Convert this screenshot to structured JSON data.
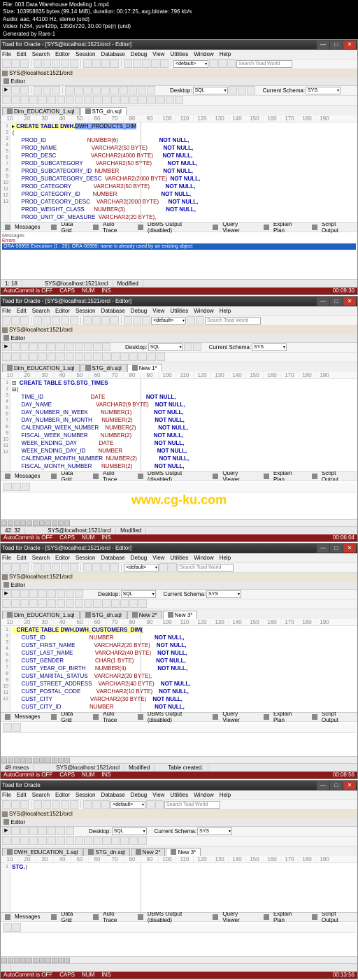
{
  "media_info": {
    "file": "File: 003 Data Warehouse Modeling 1.mp4",
    "size": "Size: 103958835 bytes (99.14 MiB), duration: 00:17:25, avg.bitrate: 796 kb/s",
    "audio": "Audio: aac, 44100 Hz, stereo (und)",
    "video": "Video: h264, yuv420p, 1350x720, 30.00 fps(r) (und)",
    "gen": "Generated by Rare-1"
  },
  "menus": [
    "File",
    "Edit",
    "Search",
    "Editor",
    "Session",
    "Database",
    "Debug",
    "View",
    "Utilities",
    "Window",
    "Help"
  ],
  "default_dd": "<default>",
  "search_ph": "Search Toad World",
  "sql_label": "SQL",
  "schema_label": "Current Schema:",
  "schema_val": "SYS",
  "conn": "SYS@localhost:1521/orcl",
  "editor_label": "Editor",
  "app1": {
    "title": "Toad for Oracle - [SYS@localhost:1521/orcl - Editor]",
    "tabs": [
      "Dim_EDUCATION_1.sql",
      "STG_dn.sql"
    ],
    "code_hl": "CREATE TABLE DWH.",
    "code_hl_sel": "DWH_PRODUCTS_DIM",
    "cols": [
      [
        "PROD_ID",
        "NUMBER(6)",
        "NOT NULL,"
      ],
      [
        "PROD_NAME",
        "VARCHAR2(50 BYTE)",
        "NOT NULL,"
      ],
      [
        "PROD_DESC",
        "VARCHAR2(4000 BYTE)",
        "NOT NULL,"
      ],
      [
        "PROD_SUBCATEGORY",
        "VARCHAR2(50 BYTE)",
        "NOT NULL,"
      ],
      [
        "PROD_SUBCATEGORY_ID",
        "NUMBER",
        "NOT NULL,"
      ],
      [
        "PROD_SUBCATEGORY_DESC",
        "VARCHAR2(2000 BYTE)",
        "NOT NULL,"
      ],
      [
        "PROD_CATEGORY",
        "VARCHAR2(50 BYTE)",
        "NOT NULL,"
      ],
      [
        "PROD_CATEGORY_ID",
        "NUMBER",
        "NOT NULL,"
      ],
      [
        "PROD_CATEGORY_DESC",
        "VARCHAR2(2000 BYTE)",
        "NOT NULL,"
      ],
      [
        "PROD_WEIGHT_CLASS",
        "NUMBER(3)",
        "NOT NULL,"
      ],
      [
        "PROD_UNIT_OF_MEASURE",
        "VARCHAR2(20 BYTE),",
        ""
      ]
    ],
    "msg_label": "Messages",
    "err_label": "Errors",
    "err_text": "ORA-00955 Execution (1 : 20): ORA-00955: name is already used by an existing object",
    "out_tabs": [
      "Messages",
      "Data Grid",
      "Auto Trace",
      "DBMS Output (disabled)",
      "Query Viewer",
      "Explain Plan",
      "Script Output"
    ],
    "status": [
      "1: 18",
      "",
      "",
      "SYS@localhost:1521/orcl",
      "Modified"
    ],
    "redbar": [
      "AutoCommit is OFF",
      "CAPS",
      "NUM",
      "INS"
    ],
    "time": "00:09:30"
  },
  "app2": {
    "title": "Toad for Oracle - [SYS@localhost:1521/orcl - Editor]",
    "tabs": [
      "Dim_EDUCATION_1.sql",
      "STG_dn.sql",
      "New 1*"
    ],
    "code_line1": "CREATE TABLE STG.STG_TIMES",
    "cols": [
      [
        "TIME_ID",
        "DATE",
        "NOT NULL,"
      ],
      [
        "DAY_NAME",
        "VARCHAR2(9 BYTE)",
        "NOT NULL,"
      ],
      [
        "DAY_NUMBER_IN_WEEK",
        "NUMBER(1)",
        "NOT NULL,"
      ],
      [
        "DAY_NUMBER_IN_MONTH",
        "NUMBER(2)",
        "NOT NULL,"
      ],
      [
        "CALENDAR_WEEK_NUMBER",
        "NUMBER(2)",
        "NOT NULL,"
      ],
      [
        "FISCAL_WEEK_NUMBER",
        "NUMBER(2)",
        "NOT NULL,"
      ],
      [
        "WEEK_ENDING_DAY",
        "DATE",
        "NOT NULL,"
      ],
      [
        "WEEK_ENDING_DAY_ID",
        "NUMBER",
        "NOT NULL,"
      ],
      [
        "CALENDAR_MONTH_NUMBER",
        "NUMBER(2)",
        "NOT NULL,"
      ],
      [
        "FISCAL_MONTH_NUMBER",
        "NUMBER(2)",
        "NOT NULL,"
      ]
    ],
    "out_label": "Data Grid",
    "out_tabs": [
      "Messages",
      "Data Grid",
      "Auto Trace",
      "DBMS Output (disabled)",
      "Query Viewer",
      "Explain Plan",
      "Script Output"
    ],
    "status": [
      "42: 32",
      "",
      "",
      "SYS@localhost:1521/orcl",
      "Modified"
    ],
    "redbar": [
      "AutoCommit is OFF",
      "CAPS",
      "NUM",
      "INS"
    ],
    "time": "00:06:04",
    "watermark": "www.cg-ku.com"
  },
  "app3": {
    "title": "Toad for Oracle - [SYS@localhost:1521/orcl - Editor]",
    "tabs": [
      "Dim_EDUCATION_1.sql",
      "STG_dn.sql",
      "New 2*",
      "New 3*"
    ],
    "code_hl": "CREATE TABLE DWH.DWH_CUSTOMERS_DIM(",
    "cols": [
      [
        "CUST_ID",
        "NUMBER",
        "NOT NULL,"
      ],
      [
        "CUST_FIRST_NAME",
        "VARCHAR2(20 BYTE)",
        "NOT NULL,"
      ],
      [
        "CUST_LAST_NAME",
        "VARCHAR2(40 BYTE)",
        "NOT NULL,"
      ],
      [
        "CUST_GENDER",
        "CHAR(1 BYTE)",
        "NOT NULL,"
      ],
      [
        "CUST_YEAR_OF_BIRTH",
        "NUMBER(4)",
        "NOT NULL,"
      ],
      [
        "CUST_MARITAL_STATUS",
        "VARCHAR2(20 BYTE),",
        ""
      ],
      [
        "CUST_STREET_ADDRESS",
        "VARCHAR2(40 BYTE)",
        "NOT NULL,"
      ],
      [
        "CUST_POSTAL_CODE",
        "VARCHAR2(10 BYTE)",
        "NOT NULL,"
      ],
      [
        "CUST_CITY",
        "VARCHAR2(30 BYTE)",
        "NOT NULL,"
      ],
      [
        "CUST_CITY_ID",
        "NUMBER",
        "NOT NULL,"
      ]
    ],
    "out_label": "Data Grid",
    "out_tabs": [
      "Messages",
      "Data Grid",
      "Auto Trace",
      "DBMS Output (disabled)",
      "Query Viewer",
      "Explain Plan",
      "Script Output"
    ],
    "status": [
      "49 msecs",
      "",
      "",
      "SYS@localhost:1521/orcl",
      "Modified",
      "",
      "Table created."
    ],
    "redbar": [
      "AutoCommit is OFF",
      "CAPS",
      "NUM",
      "INS"
    ],
    "time": "00:08:56"
  },
  "app4": {
    "title": "Toad for Oracle",
    "tabs": [
      "DWH_EDUCATION_1.sql",
      "STG_dn.sql",
      "New 2*",
      "New 3*"
    ],
    "code_text": "STG.",
    "out_tabs": [
      "Messages",
      "Data Grid",
      "Auto Trace",
      "DBMS Output (disabled)",
      "Query Viewer",
      "Explain Plan",
      "Script Output"
    ],
    "redbar": [
      "AutoCommit is OFF",
      "CAPS",
      "NUM",
      "INS"
    ],
    "time": "00:13:56"
  },
  "ruler_vals": [
    "10",
    "20",
    "30",
    "40",
    "50",
    "60",
    "70",
    "80",
    "90",
    "100",
    "110",
    "120",
    "130",
    "140",
    "150",
    "160",
    "170",
    "180",
    "190"
  ]
}
